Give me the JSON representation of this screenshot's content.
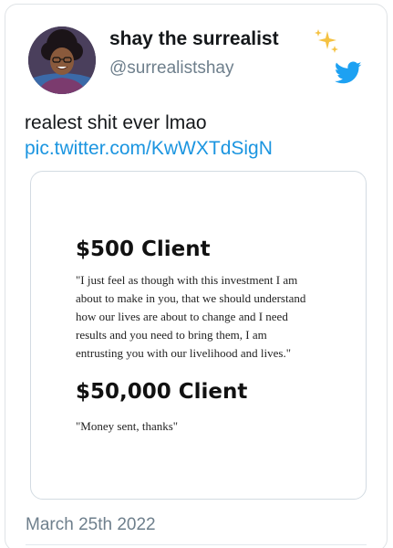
{
  "user": {
    "display_name": "shay the surrealist",
    "handle": "@surrealistshay"
  },
  "tweet": {
    "text": "realest shit ever lmao",
    "link": "pic.twitter.com/KwWXTdSigN",
    "date": "March 25th 2022"
  },
  "media": {
    "heading_1": "$500 Client",
    "quote_1": "\"I just feel as though with this investment I am\nabout to make in you, that we should understand\nhow our lives are about to change and I need\nresults and you need to bring them, I am\nentrusting you with our livelihood and lives.\"",
    "heading_2": "$50,000 Client",
    "quote_2": "\"Money sent, thanks\""
  },
  "icons": {
    "sparkles": "sparkles-icon",
    "twitter": "twitter-bird-icon"
  },
  "colors": {
    "link": "#1b95e0",
    "muted": "#6e7f8c",
    "twitter_blue": "#1da1f2",
    "sparkle": "#f5c242"
  }
}
